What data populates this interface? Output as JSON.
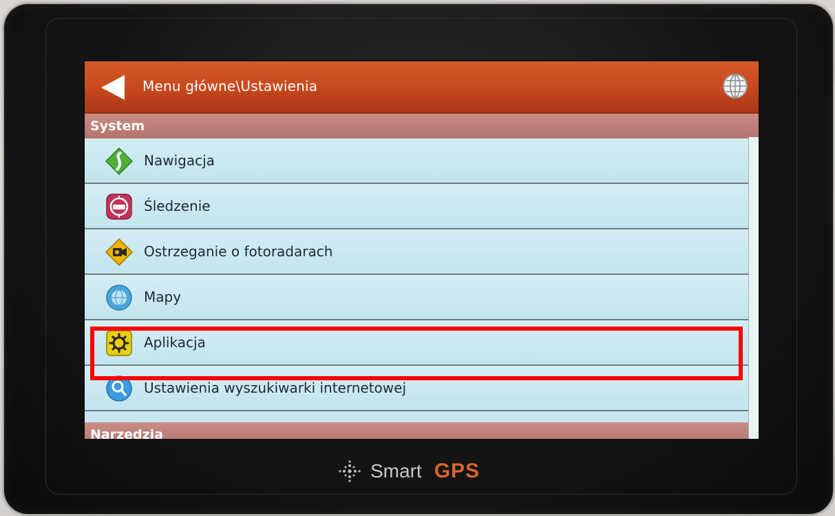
{
  "header": {
    "title": "Menu główne\\Ustawienia",
    "back_icon": "back-arrow-icon",
    "language_icon": "globe-icon"
  },
  "sections": {
    "system_label": "System",
    "next_label": "Narzędzia"
  },
  "items": [
    {
      "label": "Nawigacja",
      "icon": "navigation-road-icon",
      "icon_color": "#4caf3a"
    },
    {
      "label": "Śledzenie",
      "icon": "tracking-car-icon",
      "icon_color": "#c0335a"
    },
    {
      "label": "Ostrzeganie o fotoradarach",
      "icon": "speed-camera-icon",
      "icon_color": "#f2b400"
    },
    {
      "label": "Mapy",
      "icon": "map-globe-icon",
      "icon_color": "#4aa6d9"
    },
    {
      "label": "Aplikacja",
      "icon": "gear-icon",
      "icon_color": "#e9cf12",
      "highlighted": true
    },
    {
      "label": "Ustawienia wyszukiwarki internetowej",
      "icon": "search-icon",
      "icon_color": "#3a9be0"
    }
  ],
  "device": {
    "brand_smart": "Smart",
    "brand_gps": "GPS"
  },
  "colors": {
    "titlebar": "#c6481c",
    "section": "#b3746d",
    "list_bg": "#c9e6ee",
    "highlight_outline": "#ff0000",
    "brand_gps": "#d8652a"
  }
}
